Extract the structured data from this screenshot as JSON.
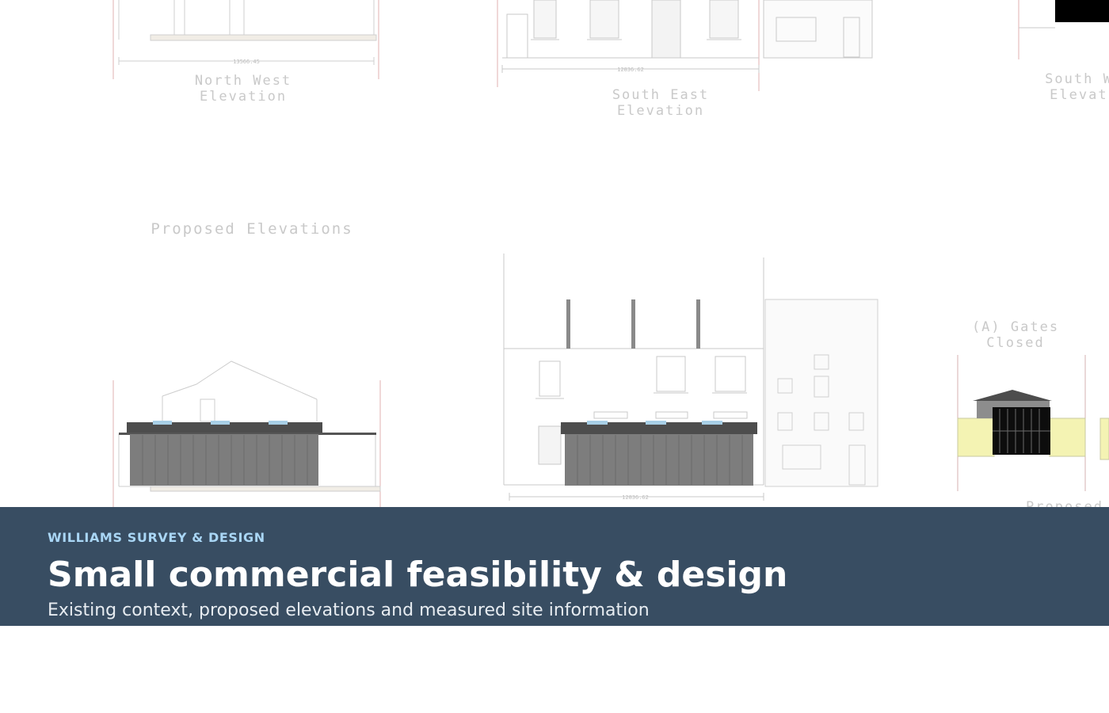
{
  "drawing": {
    "labels": {
      "north_west_line1": "North West",
      "north_west_line2": "Elevation",
      "south_east_line1": "South East",
      "south_east_line2": "Elevation",
      "south_west_line1": "South W",
      "south_west_line2": "Elevati",
      "proposed_elevations": "Proposed Elevations",
      "gates_line1": "(A) Gates",
      "gates_line2": "Closed",
      "proposed_cut": "Proposed"
    },
    "dimensions": {
      "nw_existing": "13566.45",
      "se_existing": "12836.62",
      "se_proposed": "12836.62"
    },
    "colors": {
      "cladding": "#7d7d7d",
      "roof": "#4d4d4d",
      "rooflight": "#a8cfe6",
      "boundary_fill": "#f4f3b3",
      "linework": "#c6c6c6"
    }
  },
  "hero": {
    "eyebrow": "WILLIAMS SURVEY & DESIGN",
    "title": "Small commercial feasibility & design",
    "subtitle": "Existing context, proposed elevations and measured site information"
  }
}
